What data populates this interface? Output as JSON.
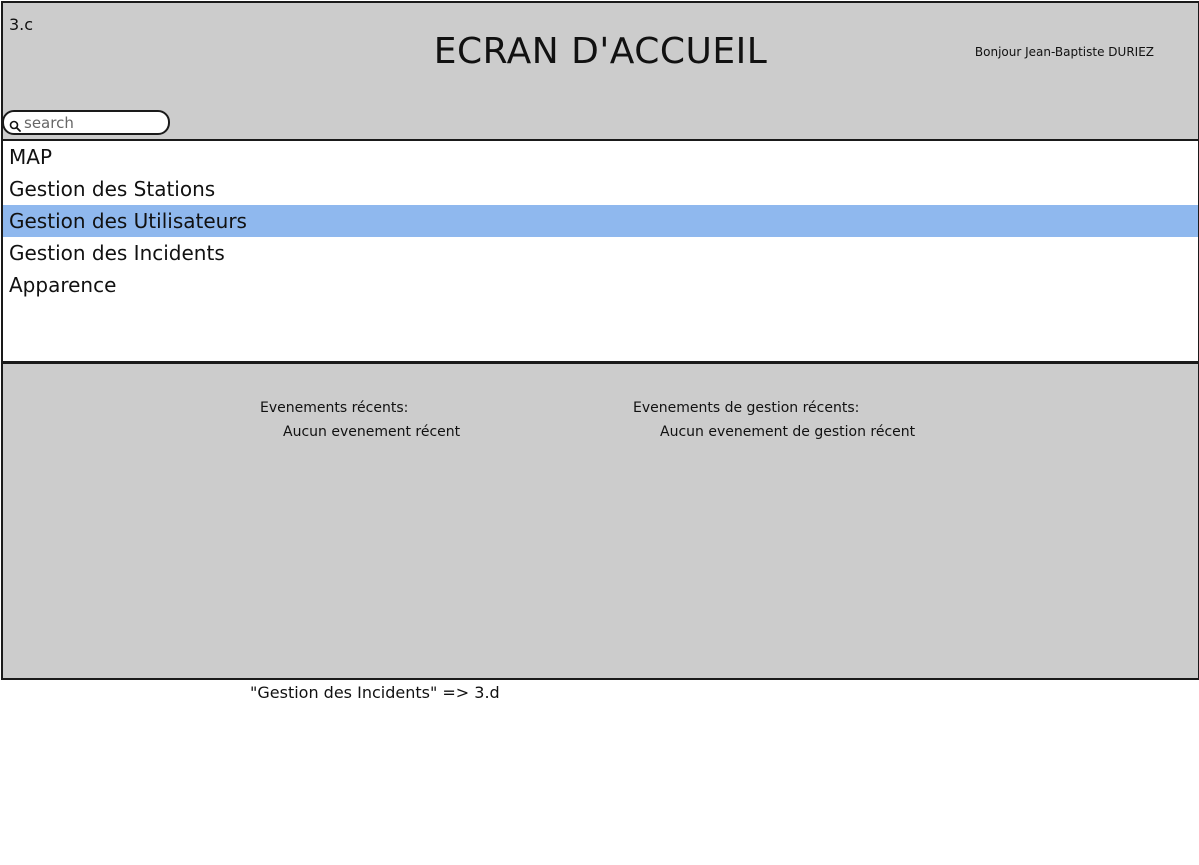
{
  "screen_id": "3.c",
  "header": {
    "title": "ECRAN D'ACCUEIL",
    "greeting": "Bonjour Jean-Baptiste DURIEZ"
  },
  "search": {
    "placeholder": "search",
    "icon": "search-icon"
  },
  "menu": {
    "items": [
      {
        "label": "MAP",
        "selected": false
      },
      {
        "label": "Gestion des Stations",
        "selected": false
      },
      {
        "label": "Gestion des Utilisateurs",
        "selected": true
      },
      {
        "label": "Gestion des Incidents",
        "selected": false
      },
      {
        "label": "Apparence",
        "selected": false
      }
    ],
    "selected_color": "#8fb8ee"
  },
  "events": {
    "recent_title": "Evenements récents:",
    "recent_empty": "Aucun evenement récent",
    "management_title": "Evenements de gestion récents:",
    "management_empty": "Aucun evenement de gestion récent"
  },
  "note": "\"Gestion des Incidents\" => 3.d",
  "colors": {
    "panel_background": "#cccccc",
    "border": "#1a1a1a"
  }
}
